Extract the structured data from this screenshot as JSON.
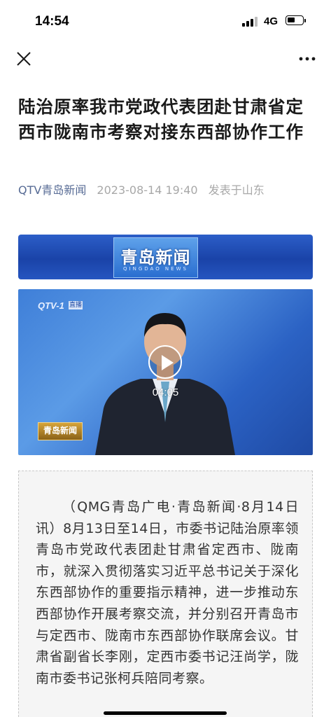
{
  "status_bar": {
    "time": "14:54",
    "network": "4G",
    "icons": [
      "signal-icon",
      "battery-icon"
    ]
  },
  "nav": {
    "close_icon": "close-icon",
    "more_icon": "more-horizontal-icon"
  },
  "article": {
    "title": "陆治原率我市党政代表团赴甘肃省定西市陇南市考察对接东西部协作工作",
    "source": "QTV青岛新闻",
    "date": "2023-08-14 19:40",
    "location": "发表于山东"
  },
  "banner": {
    "text": "青岛新闻",
    "subtext": "QINGDAO NEWS"
  },
  "video": {
    "channel_logo": "QTV-1",
    "channel_tag": "直播",
    "duration": "04:05",
    "badge": "青岛新闻",
    "play_icon": "play-icon"
  },
  "body": {
    "paragraph": "（QMG青岛广电·青岛新闻·8月14日讯）8月13日至14日，市委书记陆治原率领青岛市党政代表团赴甘肃省定西市、陇南市，就深入贯彻落实习近平总书记关于深化东西部协作的重要指示精神，进一步推动东西部协作开展考察交流，并分别召开青岛市与定西市、陇南市东西部协作联席会议。甘肃省副省长李刚，定西市委书记汪尚学，陇南市委书记张柯兵陪同考察。"
  },
  "colors": {
    "link": "#576b95",
    "meta_gray": "#a8a8a8",
    "quote_bg": "#f5f5f5"
  }
}
